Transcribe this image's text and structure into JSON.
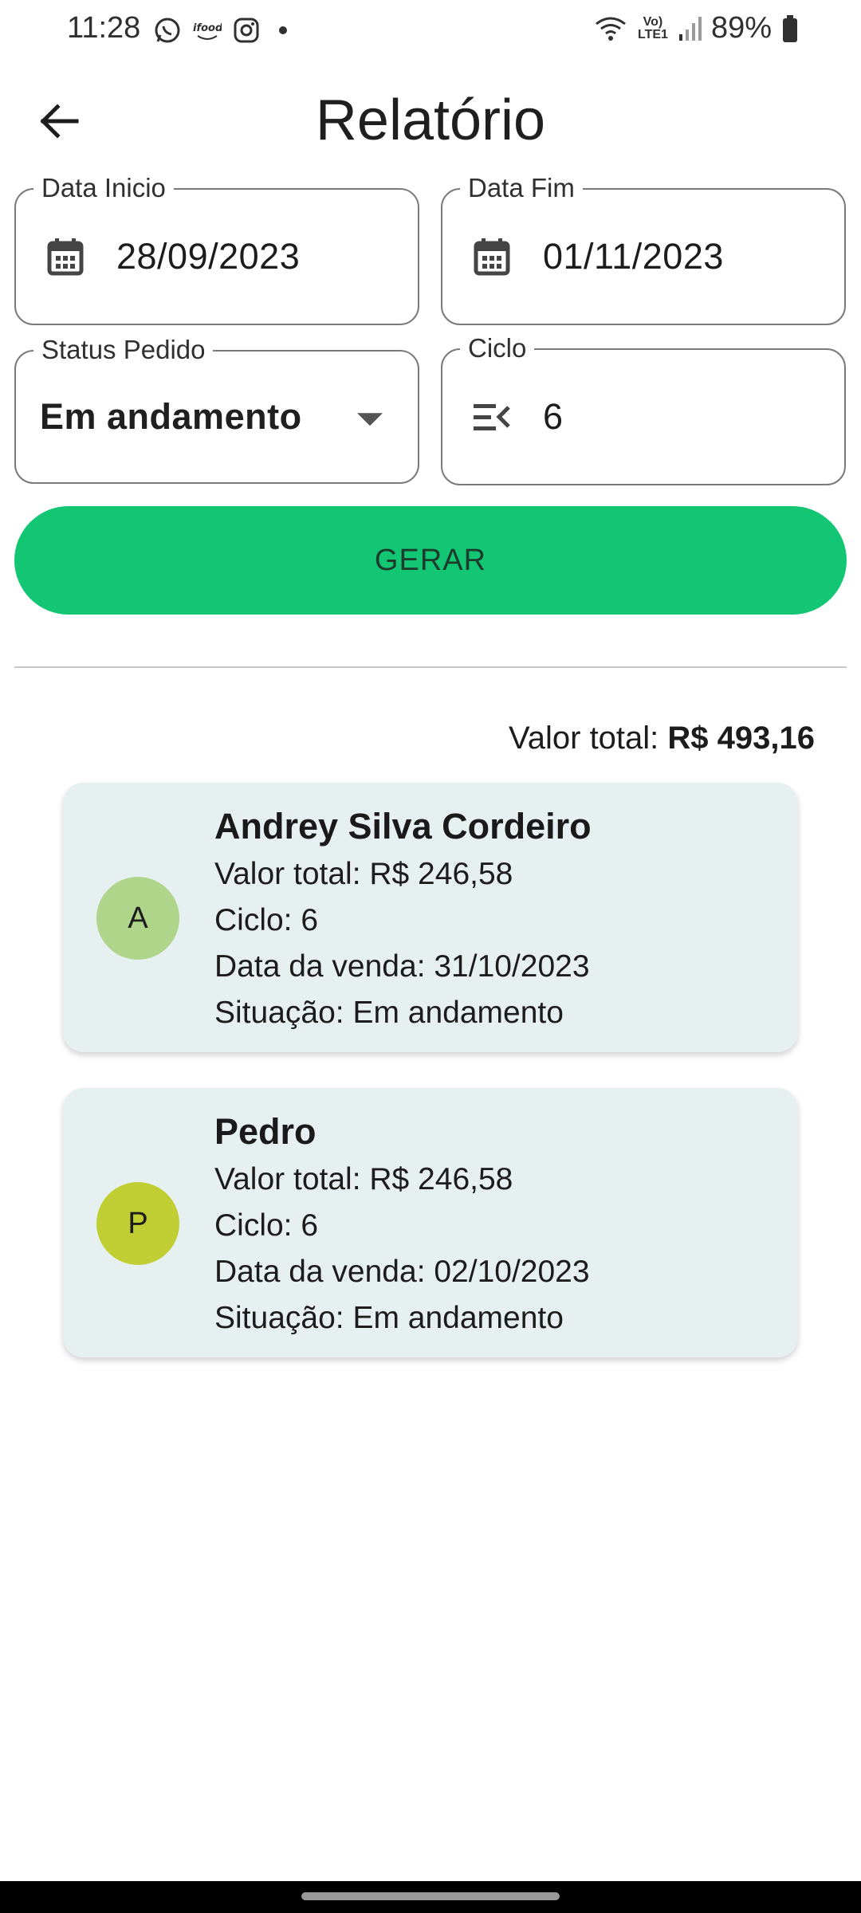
{
  "status_bar": {
    "time": "11:28",
    "notification_icons": [
      "whatsapp-icon",
      "ifood-icon",
      "instagram-icon",
      "dot-icon"
    ],
    "network_label_top": "Vo)",
    "network_label_bottom": "LTE1",
    "battery_percent": "89%"
  },
  "app_bar": {
    "title": "Relatório",
    "back_icon": "arrow-back-icon"
  },
  "filters": {
    "start_date": {
      "label": "Data Inicio",
      "value": "28/09/2023",
      "icon": "calendar-icon"
    },
    "end_date": {
      "label": "Data Fim",
      "value": "01/11/2023",
      "icon": "calendar-icon"
    },
    "status": {
      "label": "Status Pedido",
      "value": "Em andamento",
      "icon": "dropdown-arrow-icon"
    },
    "cycle": {
      "label": "Ciclo",
      "value": "6",
      "icon": "list-icon"
    }
  },
  "generate_button": {
    "label": "GERAR",
    "color": "#12c674"
  },
  "summary": {
    "label": "Valor total: ",
    "value": "R$ 493,16"
  },
  "orders": [
    {
      "avatar_letter": "A",
      "avatar_color": "#aed58a",
      "name": "Andrey Silva Cordeiro",
      "total": "Valor total: R$ 246,58",
      "cycle": "Ciclo: 6",
      "sale_date": "Data da venda: 31/10/2023",
      "situation": "Situação: Em andamento"
    },
    {
      "avatar_letter": "P",
      "avatar_color": "#c0ce34",
      "name": "Pedro",
      "total": "Valor total: R$ 246,58",
      "cycle": "Ciclo: 6",
      "sale_date": "Data da venda: 02/10/2023",
      "situation": "Situação: Em andamento"
    }
  ]
}
